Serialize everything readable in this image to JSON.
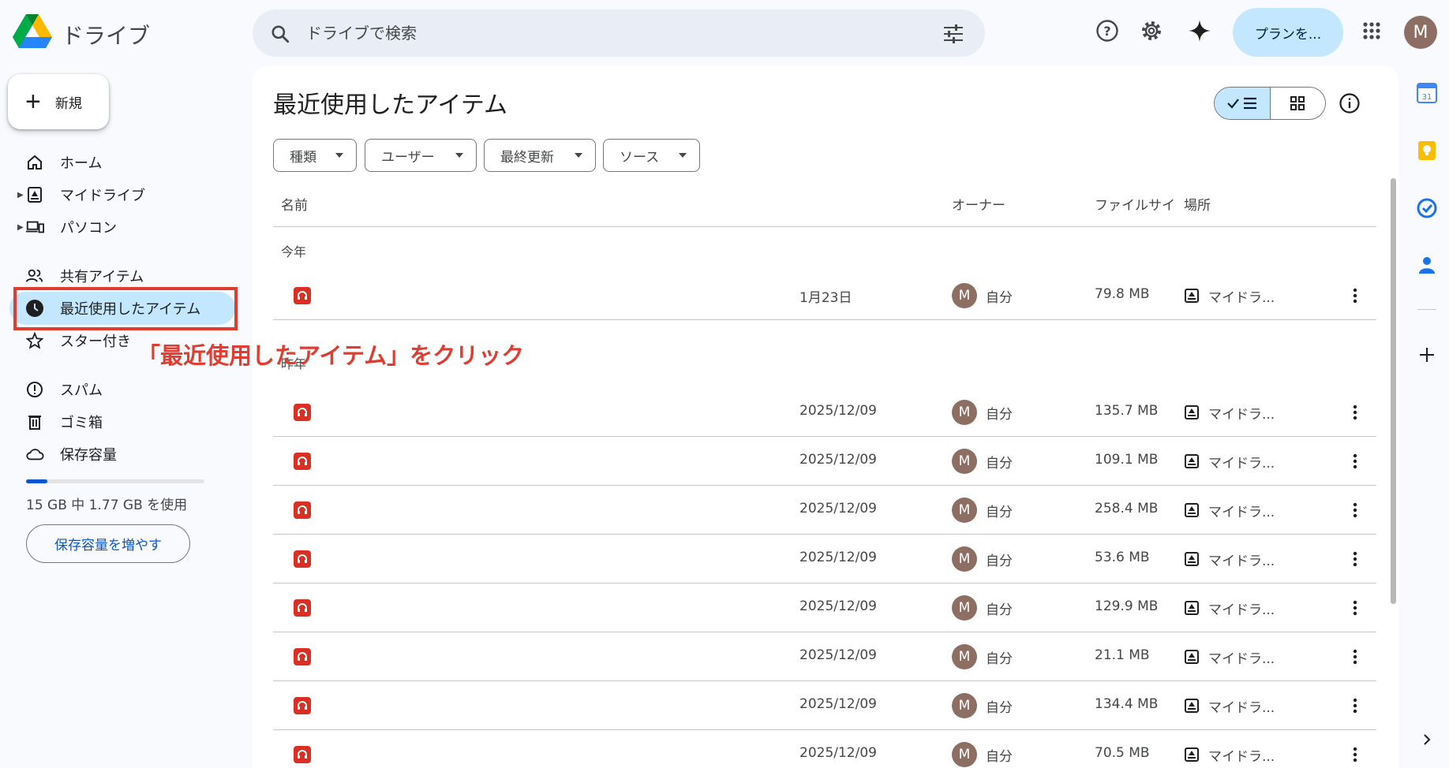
{
  "app": {
    "title": "ドライブ"
  },
  "search": {
    "placeholder": "ドライブで検索"
  },
  "header": {
    "plan_button": "プランを...",
    "avatar_initial": "M"
  },
  "sidebar": {
    "new_button": "新規",
    "items": [
      {
        "label": "ホーム",
        "icon": "home-icon"
      },
      {
        "label": "マイドライブ",
        "icon": "my-drive-icon"
      },
      {
        "label": "パソコン",
        "icon": "computer-icon"
      },
      {
        "label": "共有アイテム",
        "icon": "shared-icon"
      },
      {
        "label": "最近使用したアイテム",
        "icon": "clock-icon",
        "active": true
      },
      {
        "label": "スター付き",
        "icon": "star-icon"
      },
      {
        "label": "スパム",
        "icon": "spam-icon"
      },
      {
        "label": "ゴミ箱",
        "icon": "trash-icon"
      },
      {
        "label": "保存容量",
        "icon": "cloud-icon"
      }
    ],
    "storage_used_fraction": 0.118,
    "storage_text": "15 GB 中 1.77 GB を使用",
    "storage_button": "保存容量を増やす"
  },
  "annotation": {
    "text": "「最近使用したアイテム」をクリック",
    "color": "#e03c31"
  },
  "main": {
    "title": "最近使用したアイテム",
    "filters": [
      "種類",
      "ユーザー",
      "最終更新",
      "ソース"
    ],
    "columns": {
      "name": "名前",
      "owner": "オーナー",
      "size": "ファイルサイ",
      "location": "場所"
    },
    "groups": [
      {
        "label": "今年",
        "rows": [
          {
            "date": "1月23日",
            "owner": "自分",
            "size": "79.8 MB",
            "location": "マイドラ..."
          }
        ]
      },
      {
        "label": "昨年",
        "rows": [
          {
            "date": "2025/12/09",
            "owner": "自分",
            "size": "135.7 MB",
            "location": "マイドラ..."
          },
          {
            "date": "2025/12/09",
            "owner": "自分",
            "size": "109.1 MB",
            "location": "マイドラ..."
          },
          {
            "date": "2025/12/09",
            "owner": "自分",
            "size": "258.4 MB",
            "location": "マイドラ..."
          },
          {
            "date": "2025/12/09",
            "owner": "自分",
            "size": "53.6 MB",
            "location": "マイドラ..."
          },
          {
            "date": "2025/12/09",
            "owner": "自分",
            "size": "129.9 MB",
            "location": "マイドラ..."
          },
          {
            "date": "2025/12/09",
            "owner": "自分",
            "size": "21.1 MB",
            "location": "マイドラ..."
          },
          {
            "date": "2025/12/09",
            "owner": "自分",
            "size": "134.4 MB",
            "location": "マイドラ..."
          },
          {
            "date": "2025/12/09",
            "owner": "自分",
            "size": "70.5 MB",
            "location": "マイドラ..."
          }
        ]
      }
    ],
    "owner_avatar_initial": "M"
  },
  "rail": {
    "calendar_day": "31"
  },
  "colors": {
    "accent": "#0b57d0",
    "active_bg": "#c2e7ff",
    "file_icon": "#d93025",
    "avatar": "#8d6e63"
  }
}
